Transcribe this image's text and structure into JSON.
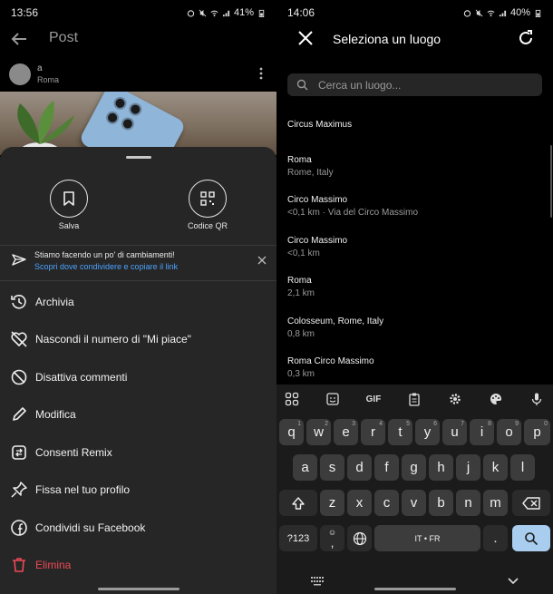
{
  "left": {
    "status": {
      "time": "13:56",
      "battery": "41%"
    },
    "header": {
      "title": "Post"
    },
    "post": {
      "author": "a",
      "location": "Roma"
    },
    "sheet": {
      "buttons": [
        {
          "label": "Salva",
          "icon": "bookmark-icon"
        },
        {
          "label": "Codice QR",
          "icon": "qr-code-icon"
        }
      ],
      "notice": {
        "text": "Stiamo facendo un po' di cambiamenti!",
        "link": "Scopri dove condividere e copiare il link"
      },
      "menu": [
        {
          "label": "Archivia",
          "icon": "archive-icon"
        },
        {
          "label": "Nascondi il numero di \"Mi piace\"",
          "icon": "hide-likes-icon"
        },
        {
          "label": "Disattiva commenti",
          "icon": "disable-comments-icon"
        },
        {
          "label": "Modifica",
          "icon": "pencil-icon"
        },
        {
          "label": "Consenti Remix",
          "icon": "remix-icon"
        },
        {
          "label": "Fissa nel tuo profilo",
          "icon": "pin-icon"
        },
        {
          "label": "Condividi su Facebook",
          "icon": "facebook-icon"
        },
        {
          "label": "Elimina",
          "icon": "trash-icon"
        }
      ]
    }
  },
  "right": {
    "status": {
      "time": "14:06",
      "battery": "40%"
    },
    "header": {
      "title": "Seleziona un luogo"
    },
    "search": {
      "placeholder": "Cerca un luogo..."
    },
    "results": [
      {
        "name": "Circus Maximus",
        "sub": ""
      },
      {
        "name": "Roma",
        "sub": "Rome, Italy"
      },
      {
        "name": "Circo Massimo",
        "sub": "<0,1 km · Via del Circo Massimo"
      },
      {
        "name": "Circo Massimo",
        "sub": "<0,1 km"
      },
      {
        "name": "Roma",
        "sub": "2,1 km"
      },
      {
        "name": "Colosseum, Rome, Italy",
        "sub": "0,8 km"
      },
      {
        "name": "Roma Circo Massimo",
        "sub": "0,3 km"
      }
    ],
    "keyboard": {
      "toolbar": {
        "gif": "GIF"
      },
      "row1": [
        "q",
        "w",
        "e",
        "r",
        "t",
        "y",
        "u",
        "i",
        "o",
        "p"
      ],
      "row1_sup": [
        "1",
        "2",
        "3",
        "4",
        "5",
        "6",
        "7",
        "8",
        "9",
        "0"
      ],
      "row2": [
        "a",
        "s",
        "d",
        "f",
        "g",
        "h",
        "j",
        "k",
        "l"
      ],
      "row3": [
        "z",
        "x",
        "c",
        "v",
        "b",
        "n",
        "m"
      ],
      "symbols": "?123",
      "comma_sup": "☺",
      "comma": ",",
      "space": "IT • FR",
      "period": "."
    }
  },
  "colors": {
    "danger": "#ed4956",
    "link": "#4aa3ff",
    "sheet": "#262626",
    "enter_key": "#a9cdee"
  }
}
